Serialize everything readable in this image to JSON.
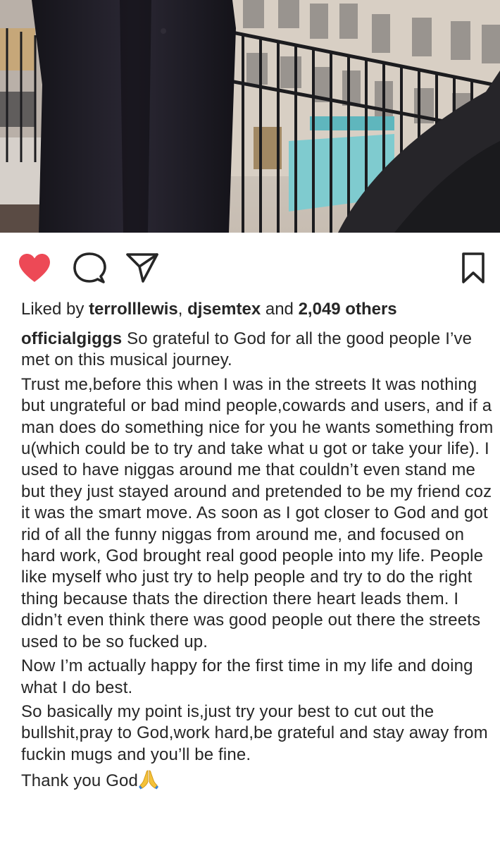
{
  "post": {
    "liked": true,
    "actions": {
      "like_icon": "heart-icon",
      "comment_icon": "comment-bubble-icon",
      "share_icon": "paper-plane-icon",
      "save_icon": "bookmark-icon"
    },
    "likes": {
      "prefix": "Liked by",
      "user1": "terrolllewis",
      "separator": ",",
      "user2": "djsemtex",
      "and_text": "and",
      "others": "2,049 others"
    },
    "caption": {
      "username": "officialgiggs",
      "paragraphs": [
        "So grateful to God for all the good people I’ve met on this musical journey.",
        "Trust me,before this when I was in the streets It was nothing but ungrateful or bad mind people,cowards and users, and if a man does do something nice for you he wants something from u(which could be to try and take what u got or take your life). I used to have niggas around me that couldn’t even stand me but they just stayed around and pretended to be my friend coz it was the smart move. As soon as I got closer to God and got rid of all the funny niggas from around me, and focused on hard work, God brought real good people into my life. People like myself who just try to help people and try to do the right thing because thats the direction there heart leads them. I didn’t even think there was good people out there the streets used to be so fucked up.",
        "Now I’m actually happy for the first time in my life and doing what I do best.",
        "So basically my point is,just try your best to cut out the bullshit,pray to God,work hard,be grateful and stay away from fuckin mugs and you’ll be fine.",
        "Thank you God"
      ],
      "end_emoji": "praying-hands-icon"
    },
    "colors": {
      "heart": "#ed4956",
      "icon": "#262626",
      "text": "#262626"
    }
  }
}
